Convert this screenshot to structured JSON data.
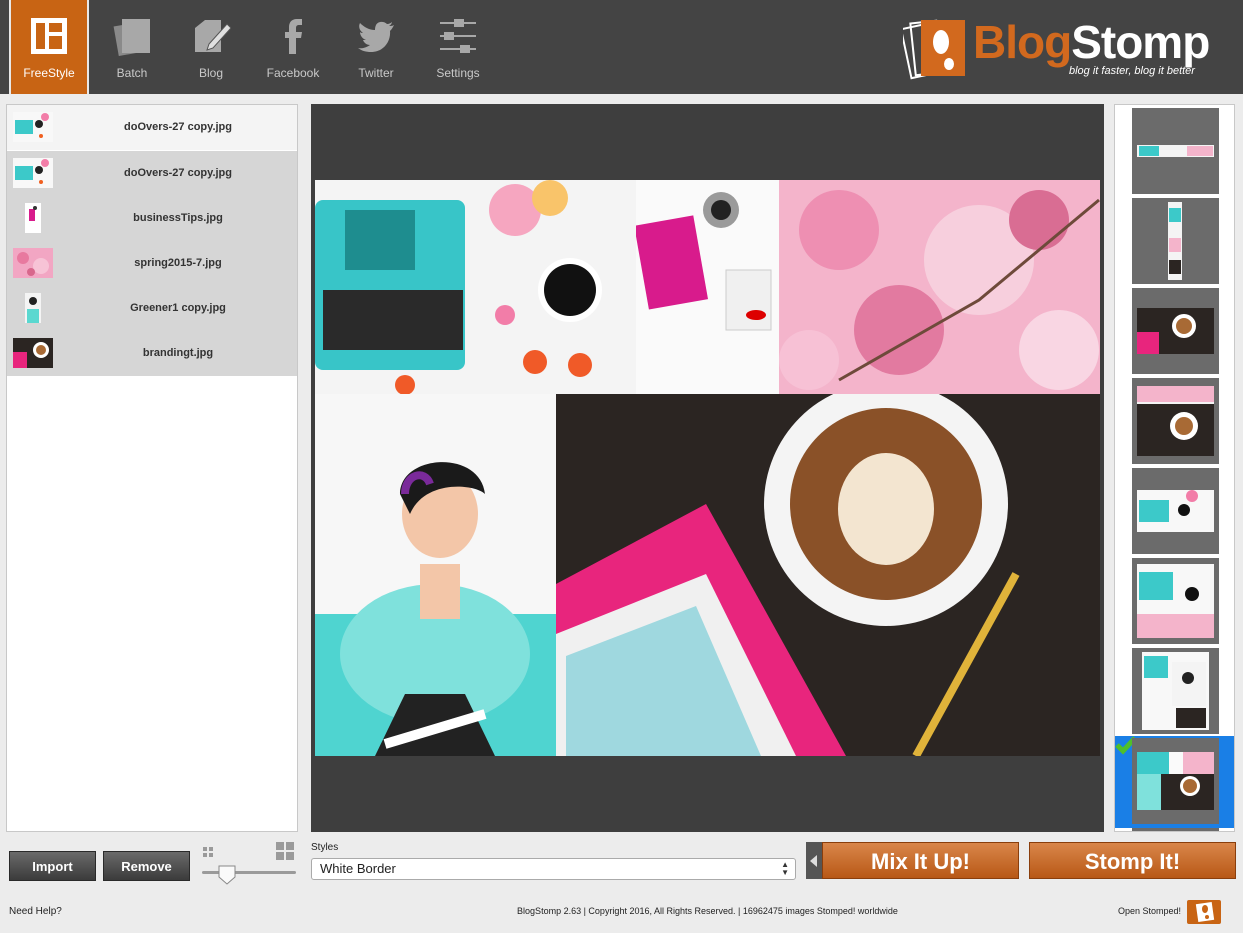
{
  "toolbar": {
    "tools": [
      {
        "label": "FreeStyle",
        "icon": "freestyle-layout-icon",
        "active": true
      },
      {
        "label": "Batch",
        "icon": "batch-stack-icon"
      },
      {
        "label": "Blog",
        "icon": "blog-edit-icon"
      },
      {
        "label": "Facebook",
        "icon": "facebook-icon"
      },
      {
        "label": "Twitter",
        "icon": "twitter-bird-icon"
      },
      {
        "label": "Settings",
        "icon": "sliders-icon"
      }
    ]
  },
  "logo": {
    "part1": "Blog",
    "part2": "Stomp",
    "tagline": "blog it faster, blog it better"
  },
  "files": [
    {
      "name": "doOvers-27 copy.jpg"
    },
    {
      "name": "doOvers-27 copy.jpg"
    },
    {
      "name": "businessTips.jpg"
    },
    {
      "name": "spring2015-7.jpg"
    },
    {
      "name": "Greener1 copy.jpg"
    },
    {
      "name": "brandingt.jpg"
    }
  ],
  "buttons": {
    "import": "Import",
    "remove": "Remove",
    "mix": "Mix It Up!",
    "stomp": "Stomp It!"
  },
  "styles": {
    "label": "Styles",
    "selected": "White Border"
  },
  "footer": {
    "help": "Need Help?",
    "copyright": "BlogStomp 2.63 | Copyright 2016, All Rights Reserved. | 16962475 images Stomped! worldwide",
    "open": "Open Stomped!"
  },
  "colors": {
    "accent": "#c86414",
    "toolbar": "#444444",
    "canvas": "#3e3e3e",
    "selection": "#1a7fe6"
  }
}
